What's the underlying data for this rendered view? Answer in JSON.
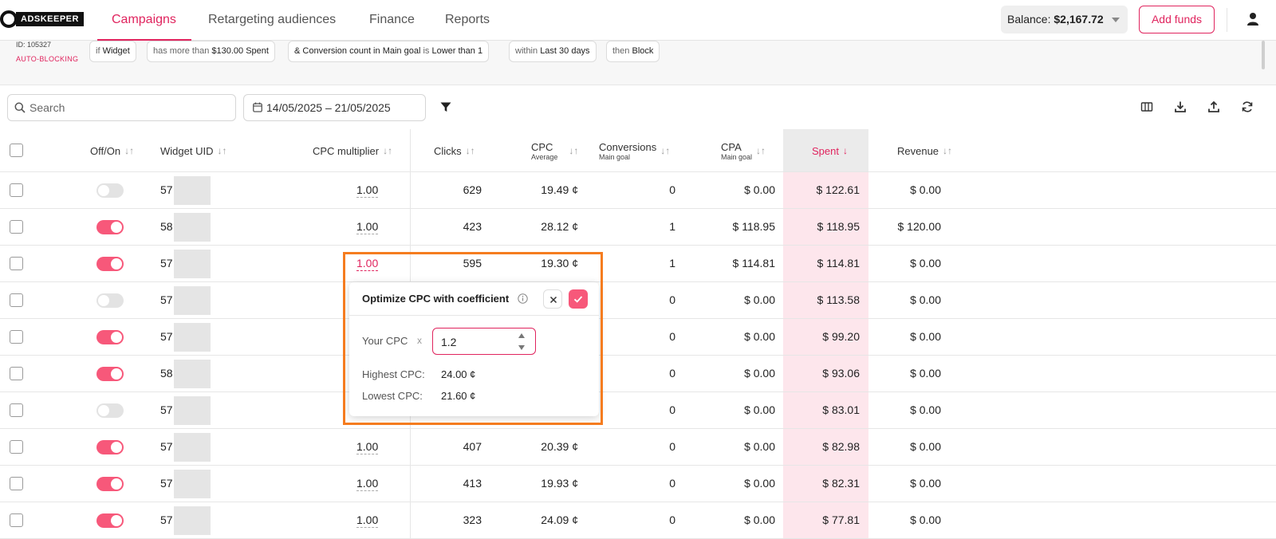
{
  "app": {
    "brand": "ADSKEEPER",
    "tabs": [
      {
        "label": "Campaigns",
        "active": true
      },
      {
        "label": "Retargeting audiences",
        "active": false
      },
      {
        "label": "Finance",
        "active": false
      },
      {
        "label": "Reports",
        "active": false
      }
    ],
    "balance_label": "Balance:",
    "balance_value": "$2,167.72",
    "add_funds_label": "Add funds"
  },
  "rule": {
    "id_text": "ID: 105327",
    "type_text": "AUTO-BLOCKING",
    "chips": [
      {
        "a": "if",
        "b": "Widget"
      },
      {
        "a": "has more than",
        "b": "$130.00 Spent"
      },
      {
        "a": "& Conversion count in",
        "b": "Main goal",
        "c": "is",
        "d": "Lower than",
        "e": "1"
      },
      {
        "a": "within",
        "b": "Last 30 days"
      },
      {
        "a": "then",
        "b": "Block"
      }
    ]
  },
  "toolbar": {
    "search_placeholder": "Search",
    "date_range": "14/05/2025 – 21/05/2025"
  },
  "table": {
    "headers": {
      "offon": "Off/On",
      "uid": "Widget UID",
      "cpcm": "CPC multiplier",
      "clicks": "Clicks",
      "cpc": "CPC",
      "cpc_sub": "Average",
      "conv": "Conversions",
      "conv_sub": "Main goal",
      "cpa": "CPA",
      "cpa_sub": "Main goal",
      "spent": "Spent",
      "revenue": "Revenue"
    },
    "sort_glyph": "↓↑",
    "spent_sort_glyph": "↓",
    "rows": [
      {
        "on": false,
        "uid": "57",
        "cpcm": "1.00",
        "clicks": "629",
        "cpc": "19.49 ¢",
        "conv": "0",
        "cpa": "$ 0.00",
        "spent": "$ 122.61",
        "revenue": "$ 0.00"
      },
      {
        "on": true,
        "uid": "58",
        "cpcm": "1.00",
        "clicks": "423",
        "cpc": "28.12 ¢",
        "conv": "1",
        "cpa": "$ 118.95",
        "spent": "$ 118.95",
        "revenue": "$ 120.00"
      },
      {
        "on": true,
        "uid": "57",
        "cpcm": "1.00",
        "clicks": "595",
        "cpc": "19.30 ¢",
        "conv": "1",
        "cpa": "$ 114.81",
        "spent": "$ 114.81",
        "revenue": "$ 0.00"
      },
      {
        "on": false,
        "uid": "57",
        "cpcm": "",
        "clicks": "",
        "cpc": "",
        "conv": "0",
        "cpa": "$ 0.00",
        "spent": "$ 113.58",
        "revenue": "$ 0.00"
      },
      {
        "on": true,
        "uid": "57",
        "cpcm": "",
        "clicks": "",
        "cpc": "",
        "conv": "0",
        "cpa": "$ 0.00",
        "spent": "$ 99.20",
        "revenue": "$ 0.00"
      },
      {
        "on": true,
        "uid": "58",
        "cpcm": "",
        "clicks": "",
        "cpc": "",
        "conv": "0",
        "cpa": "$ 0.00",
        "spent": "$ 93.06",
        "revenue": "$ 0.00"
      },
      {
        "on": false,
        "uid": "57",
        "cpcm": "",
        "clicks": "",
        "cpc": "",
        "conv": "0",
        "cpa": "$ 0.00",
        "spent": "$ 83.01",
        "revenue": "$ 0.00"
      },
      {
        "on": true,
        "uid": "57",
        "cpcm": "1.00",
        "clicks": "407",
        "cpc": "20.39 ¢",
        "conv": "0",
        "cpa": "$ 0.00",
        "spent": "$ 82.98",
        "revenue": "$ 0.00"
      },
      {
        "on": true,
        "uid": "57",
        "cpcm": "1.00",
        "clicks": "413",
        "cpc": "19.93 ¢",
        "conv": "0",
        "cpa": "$ 0.00",
        "spent": "$ 82.31",
        "revenue": "$ 0.00"
      },
      {
        "on": true,
        "uid": "57",
        "cpcm": "1.00",
        "clicks": "323",
        "cpc": "24.09 ¢",
        "conv": "0",
        "cpa": "$ 0.00",
        "spent": "$ 77.81",
        "revenue": "$ 0.00"
      }
    ]
  },
  "popup": {
    "title": "Optimize CPC with coefficient",
    "your_cpc_label": "Your CPC",
    "times": "x",
    "coefficient": "1.2",
    "highest_label": "Highest CPC:",
    "highest_value": "24.00 ¢",
    "lowest_label": "Lowest CPC:",
    "lowest_value": "21.60 ¢"
  },
  "colors": {
    "accent": "#e0245e",
    "toggle_on": "#f7587a",
    "highlight": "#f57c1f",
    "spent_column": "#fde6ec"
  }
}
